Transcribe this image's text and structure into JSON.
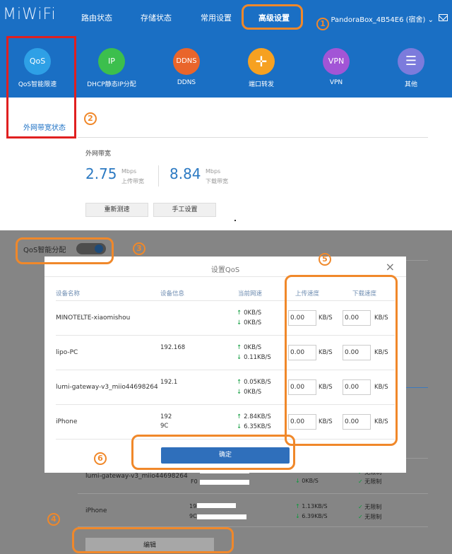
{
  "header": {
    "logo": "MiWiFi",
    "nav": [
      "路由状态",
      "存储状态",
      "常用设置",
      "高级设置"
    ],
    "router_name": "PandoraBox_4B54E6 (宿舍)"
  },
  "features": [
    {
      "icon": "QoS",
      "label": "QoS智能限速",
      "color": "#2ea0e6"
    },
    {
      "icon": "IP",
      "label": "DHCP静态IP分配",
      "color": "#3cbf4d"
    },
    {
      "icon": "DDNS",
      "label": "DDNS",
      "color": "#e9652b"
    },
    {
      "icon": "port-forward-icon",
      "label": "端口转发",
      "color": "#f6a121"
    },
    {
      "icon": "VPN",
      "label": "VPN",
      "color": "#a255d6"
    },
    {
      "icon": "menu-icon",
      "label": "其他",
      "color": "#7c7bdc"
    }
  ],
  "wan": {
    "tab": "外网带宽状态",
    "title": "外网带宽",
    "upload_value": "2.75",
    "upload_unit": "Mbps",
    "upload_label": "上传带宽",
    "download_value": "8.84",
    "download_unit": "Mbps",
    "download_label": "下载带宽",
    "retest_label": "重新测速",
    "manual_label": "手工设置"
  },
  "qos_toggle_label": "QoS智能分配",
  "modal": {
    "title": "设置QoS",
    "close": "×",
    "headers": [
      "设备名称",
      "设备信息",
      "当前网速",
      "上传速度",
      "下载速度"
    ],
    "rows": [
      {
        "name": "MINOTELTE-xiaomishou",
        "info1": "",
        "info2": "",
        "up": "0KB/S",
        "down": "0KB/S",
        "up_limit": "0.00",
        "down_limit": "0.00"
      },
      {
        "name": "lipo-PC",
        "info1": "192.168",
        "info2": "",
        "up": "0KB/S",
        "down": "0.11KB/S",
        "up_limit": "0.00",
        "down_limit": "0.00"
      },
      {
        "name": "lumi-gateway-v3_miio44698264",
        "info1": "192.1",
        "info2": "",
        "up": "0.05KB/S",
        "down": "0KB/S",
        "up_limit": "0.00",
        "down_limit": "0.00"
      },
      {
        "name": "iPhone",
        "info1": "192",
        "info2": "9C",
        "up": "2.84KB/S",
        "down": "6.35KB/S",
        "up_limit": "0.00",
        "down_limit": "0.00"
      }
    ],
    "unit": "KB/S",
    "confirm_label": "确定"
  },
  "background_rows": [
    {
      "name": "lumi-gateway-v3_miio44698264",
      "info": "F0",
      "up": "",
      "down": "0KB/S",
      "limit": "无限制"
    },
    {
      "name": "iPhone",
      "info1": "19",
      "info2": "9C",
      "up": "1.13KB/S",
      "down": "6.39KB/S",
      "up_limit": "无限制",
      "down_limit": "无限制"
    }
  ],
  "background_top_limit": "无限制",
  "edit_label": "编辑",
  "annotations": [
    "1",
    "2",
    "3",
    "4",
    "5",
    "6"
  ],
  "colors": {
    "brand_blue": "#1a6fc4",
    "annotation_orange": "#f0882a",
    "annotation_red": "#e02020",
    "speed_blue": "#2b79c2",
    "confirm_blue": "#2f6fbb"
  }
}
